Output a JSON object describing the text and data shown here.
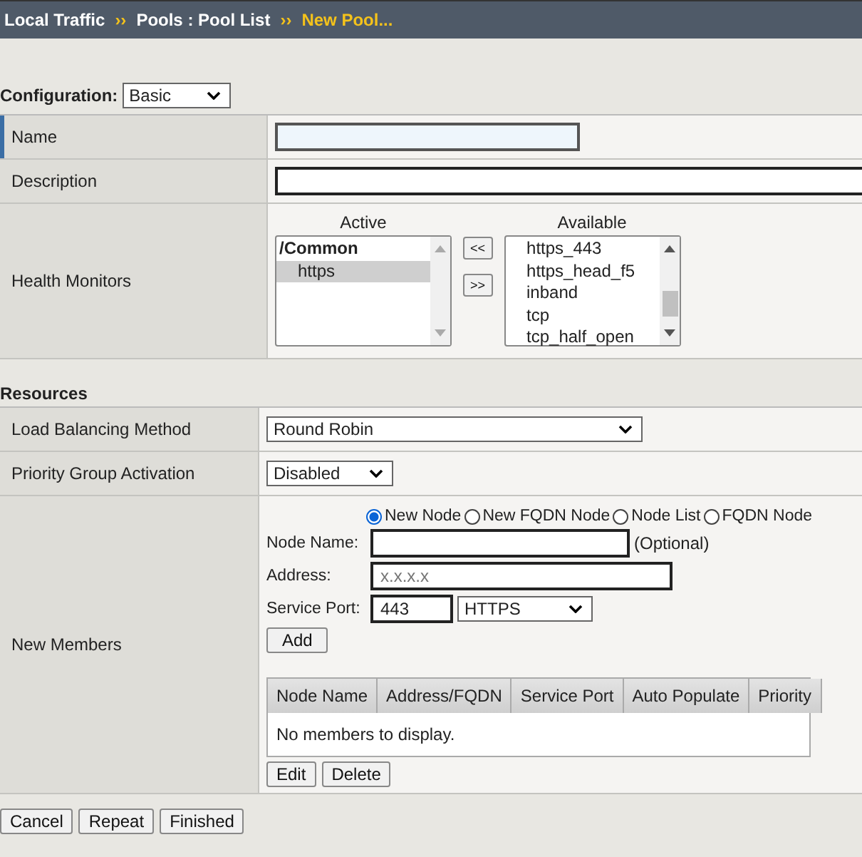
{
  "breadcrumb": {
    "items": [
      "Local Traffic",
      "Pools : Pool List"
    ],
    "current": "New Pool...",
    "separator": "››"
  },
  "configuration": {
    "label": "Configuration:",
    "value": "Basic"
  },
  "general": [
    {
      "label": "Name",
      "focused": true
    },
    {
      "label": "Description",
      "focused": false
    }
  ],
  "health_monitors": {
    "label": "Health Monitors",
    "active_title": "Active",
    "available_title": "Available",
    "active": [
      {
        "label": "/Common",
        "kind": "group",
        "selected": false
      },
      {
        "label": "https",
        "kind": "item",
        "selected": true
      }
    ],
    "move_buttons": [
      "<<",
      ">>"
    ],
    "available": [
      {
        "label": "https_443",
        "selected": false
      },
      {
        "label": "https_head_f5",
        "selected": false
      },
      {
        "label": "inband",
        "selected": false
      },
      {
        "label": "tcp",
        "selected": false
      },
      {
        "label": "tcp_half_open",
        "selected": false
      }
    ]
  },
  "resources": {
    "title": "Resources",
    "load_balancing": {
      "label": "Load Balancing Method",
      "value": "Round Robin"
    },
    "priority_group": {
      "label": "Priority Group Activation",
      "value": "Disabled"
    },
    "new_members": {
      "label": "New Members",
      "modes": [
        {
          "label": "New Node",
          "selected": true
        },
        {
          "label": "New FQDN Node",
          "selected": false
        },
        {
          "label": "Node List",
          "selected": false
        },
        {
          "label": "FQDN Node",
          "selected": false
        }
      ],
      "node_name": {
        "label": "Node Name:",
        "hint": "(Optional)"
      },
      "address": {
        "label": "Address:",
        "placeholder": "x.x.x.x"
      },
      "service_port": {
        "label": "Service Port:",
        "value": "443",
        "service": "HTTPS"
      },
      "add_button": "Add",
      "columns": [
        "Node Name",
        "Address/FQDN",
        "Service Port",
        "Auto Populate",
        "Priority"
      ],
      "empty_message": "No members to display.",
      "row_buttons": [
        "Edit",
        "Delete"
      ]
    }
  },
  "footer_buttons": [
    "Cancel",
    "Repeat",
    "Finished"
  ]
}
